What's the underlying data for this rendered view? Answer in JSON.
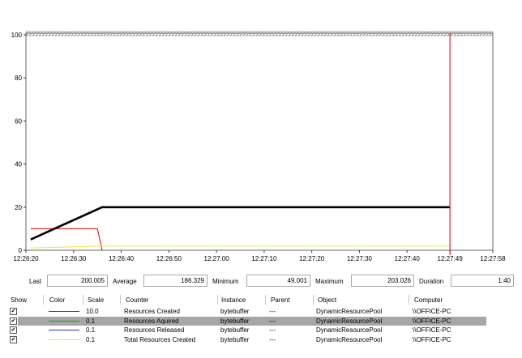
{
  "chart_data": {
    "type": "line",
    "title": "",
    "xlabel": "",
    "ylabel": "",
    "ylim": [
      0,
      100
    ],
    "y_ticks": [
      "0",
      "20",
      "40",
      "60",
      "80",
      "100"
    ],
    "x_ticks": [
      "12:26:20",
      "12:26:30",
      "12:26:40",
      "12:26:50",
      "12:27:00",
      "12:27:10",
      "12:27:20",
      "12:27:30",
      "12:27:40",
      "12:27:49",
      "12:27:58"
    ],
    "grid": false,
    "time_cursor": "12:27:49",
    "series": [
      {
        "name": "Resources Created",
        "color": "#e00000",
        "x": [
          "12:26:21",
          "12:26:35",
          "12:26:36"
        ],
        "y": [
          10,
          10,
          0
        ]
      },
      {
        "name": "Resources Aquired",
        "color": "#000000",
        "x": [
          "12:26:21",
          "12:26:27",
          "12:26:31",
          "12:26:36",
          "12:27:10",
          "12:27:30",
          "12:27:49"
        ],
        "y": [
          5,
          11,
          15,
          20,
          20,
          20,
          20
        ]
      },
      {
        "name": "Resources Released",
        "color": "#2a2ad0",
        "x": [],
        "y": []
      },
      {
        "name": "Total Resources Created",
        "color": "#e8e840",
        "x": [
          "12:26:21",
          "12:26:36",
          "12:27:49"
        ],
        "y": [
          1,
          2,
          2
        ]
      }
    ]
  },
  "stats": {
    "last_label": "Last",
    "last_value": "200.005",
    "average_label": "Average",
    "average_value": "186.329",
    "minimum_label": "Minimum",
    "minimum_value": "49.001",
    "maximum_label": "Maximum",
    "maximum_value": "203.026",
    "duration_label": "Duration",
    "duration_value": "1:40"
  },
  "table": {
    "headers": {
      "show": "Show",
      "color": "Color",
      "scale": "Scale",
      "counter": "Counter",
      "instance": "Instance",
      "parent": "Parent",
      "object": "Object",
      "computer": "Computer"
    },
    "rows": [
      {
        "checked": true,
        "color": "#e00000",
        "scale": "10.0",
        "counter": "Resources Created",
        "instance": "bytebuffer",
        "parent": "---",
        "object": "DynamicResourcePool",
        "computer": "\\\\OFFICE-PC",
        "selected": false
      },
      {
        "checked": true,
        "color": "#20a020",
        "scale": "0.1",
        "counter": "Resources Aquired",
        "instance": "bytebuffer",
        "parent": "---",
        "object": "DynamicResourcePool",
        "computer": "\\\\OFFICE-PC",
        "selected": true
      },
      {
        "checked": true,
        "color": "#2a2ad0",
        "scale": "0.1",
        "counter": "Resources Released",
        "instance": "bytebuffer",
        "parent": "---",
        "object": "DynamicResourcePool",
        "computer": "\\\\OFFICE-PC",
        "selected": false
      },
      {
        "checked": true,
        "color": "#e8e840",
        "scale": "0.1",
        "counter": "Total Resources Created",
        "instance": "bytebuffer",
        "parent": "---",
        "object": "DynamicResourcePool",
        "computer": "\\\\OFFICE-PC",
        "selected": false
      }
    ]
  }
}
